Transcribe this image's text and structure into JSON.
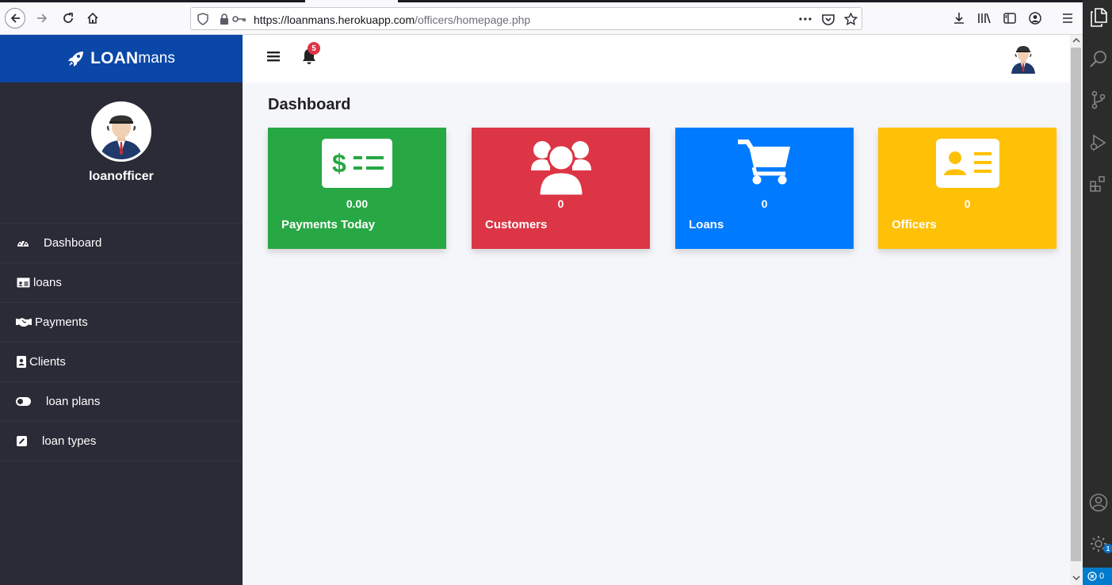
{
  "browser": {
    "url_host": "https://loanmans.herokuapp.com",
    "url_path": "/officers/homepage.php"
  },
  "brand": {
    "bold": "LOAN",
    "light": "mans"
  },
  "profile": {
    "name": "loanofficer"
  },
  "sidebar": {
    "items": [
      {
        "label": "Dashboard",
        "icon": "dashboard-icon"
      },
      {
        "label": "loans",
        "icon": "id-card-icon"
      },
      {
        "label": "Payments",
        "icon": "handshake-icon"
      },
      {
        "label": "Clients",
        "icon": "address-book-icon"
      },
      {
        "label": "loan plans",
        "icon": "toggle-icon"
      },
      {
        "label": "loan types",
        "icon": "edit-icon"
      }
    ]
  },
  "topbar": {
    "notifications": "5"
  },
  "main": {
    "title": "Dashboard"
  },
  "cards": [
    {
      "value": "0.00",
      "label": "Payments Today",
      "color": "#28a745",
      "icon": "money-check-icon"
    },
    {
      "value": "0",
      "label": "Customers",
      "color": "#dc3545",
      "icon": "users-icon"
    },
    {
      "value": "0",
      "label": "Loans",
      "color": "#007bff",
      "icon": "cart-icon"
    },
    {
      "value": "0",
      "label": "Officers",
      "color": "#ffc107",
      "icon": "id-badge-icon"
    }
  ],
  "vscode": {
    "settings_badge": "1",
    "status_errors": "0"
  }
}
